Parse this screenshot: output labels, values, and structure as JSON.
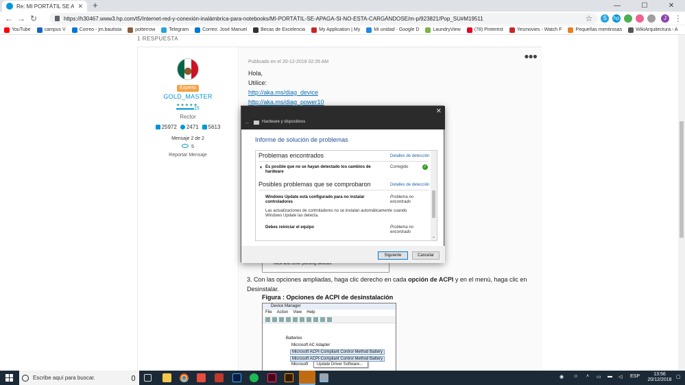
{
  "browser": {
    "tab_title": "Re: MI PORTÁTIL SE APAGA SI NO...",
    "url": "https://h30467.www3.hp.com/t5/Internet-red-y-conexión-inalámbrica-para-notebooks/MI-PORTÁTIL-SE-APAGA-SI-NO-ESTA-CARGÁNDOSE/m-p/923821/Pop_SU#M19511",
    "profile_letter": "J",
    "bookmarks": [
      {
        "label": "YouTube",
        "color": "#ff0000"
      },
      {
        "label": "campus V",
        "color": "#1565c0"
      },
      {
        "label": "Correo - jm.bautista",
        "color": "#0078d4"
      },
      {
        "label": "potterrow",
        "color": "#8b5e3c"
      },
      {
        "label": "Telegram",
        "color": "#2aa3df"
      },
      {
        "label": "Correo: José Manuel",
        "color": "#0078d4"
      },
      {
        "label": "Becas de Excelencia",
        "color": "#333333"
      },
      {
        "label": "My Application | My",
        "color": "#c62828"
      },
      {
        "label": "Mi unidad - Google D",
        "color": "#1e88e5"
      },
      {
        "label": "LaundryView",
        "color": "#7cb342"
      },
      {
        "label": "(78) Pinterest",
        "color": "#e60023"
      },
      {
        "label": "Yesmovies - Watch F",
        "color": "#c62828"
      },
      {
        "label": "Pequeñas mentirosas",
        "color": "#e67e22"
      },
      {
        "label": "WikiArquitectura - A",
        "color": "#555555"
      }
    ]
  },
  "post": {
    "replies_label": "1 RESPUESTA",
    "author": {
      "badge": "Experto",
      "username": "GOLD_MASTER",
      "rank_level": "15",
      "rank": "Rector",
      "posts": "25972",
      "solutions": "2471",
      "kudos": "5613",
      "message_num": "Mensaje 2 de 2",
      "views": "5",
      "report": "Reportar Mensaje"
    },
    "date": "Publicado en el 20-12-2018 02:35 AM",
    "greeting": "Hola,",
    "utilice": "Utilice:",
    "link1": "http://aka.ms/diag_device",
    "link2": "http://aka.ms/diag_power10",
    "step3_num": "3.",
    "step3_a": "Con las opciones ampliadas, haga clic derecho en cada ",
    "step3_b": "opción de ACPI",
    "step3_c": " y en el menú, haga clic en Desinstalar.",
    "figure_title": "Figura : Opciones de ACPI de desinstalación",
    "devtop_row": "Mice and other pointing devices",
    "device_manager": {
      "title": "Device Manager",
      "menu": [
        "File",
        "Action",
        "View",
        "Help"
      ],
      "rows": [
        "Batteries",
        "Microsoft AC Adapter",
        "Microsoft ACPI-Compliant Control Method Battery",
        "Microsoft ACPI-Compliant Control Method Battery",
        "Microsoft"
      ],
      "context_item": "Update Driver Software..."
    }
  },
  "dialog": {
    "header_title": "Hardware y dispositivos",
    "report_title": "Informe de solución de problemas",
    "found_title": "Problemas encontrados",
    "details_label": "Detalles de detección",
    "found_item": "Es posible que no se hayan detectado los cambios de hardware",
    "found_status": "Corregido",
    "checked_title": "Posibles problemas que se comprobaron",
    "check1_title": "Windows Update está configurado para no instalar controladores",
    "check1_status": "Problema no encontrado",
    "check1_desc": "Las actualizaciones de controladores no se instalan automáticamente cuando Windows Update las detecta.",
    "check2_title": "Debes reiniciar el equipo",
    "check2_status": "Problema no encontrado",
    "next_button": "Siguiente",
    "cancel_button": "Cancelar"
  },
  "taskbar": {
    "search_placeholder": "Escribe aquí para buscar.",
    "language": "ESP",
    "time": "13:56",
    "date": "20/12/2018"
  }
}
